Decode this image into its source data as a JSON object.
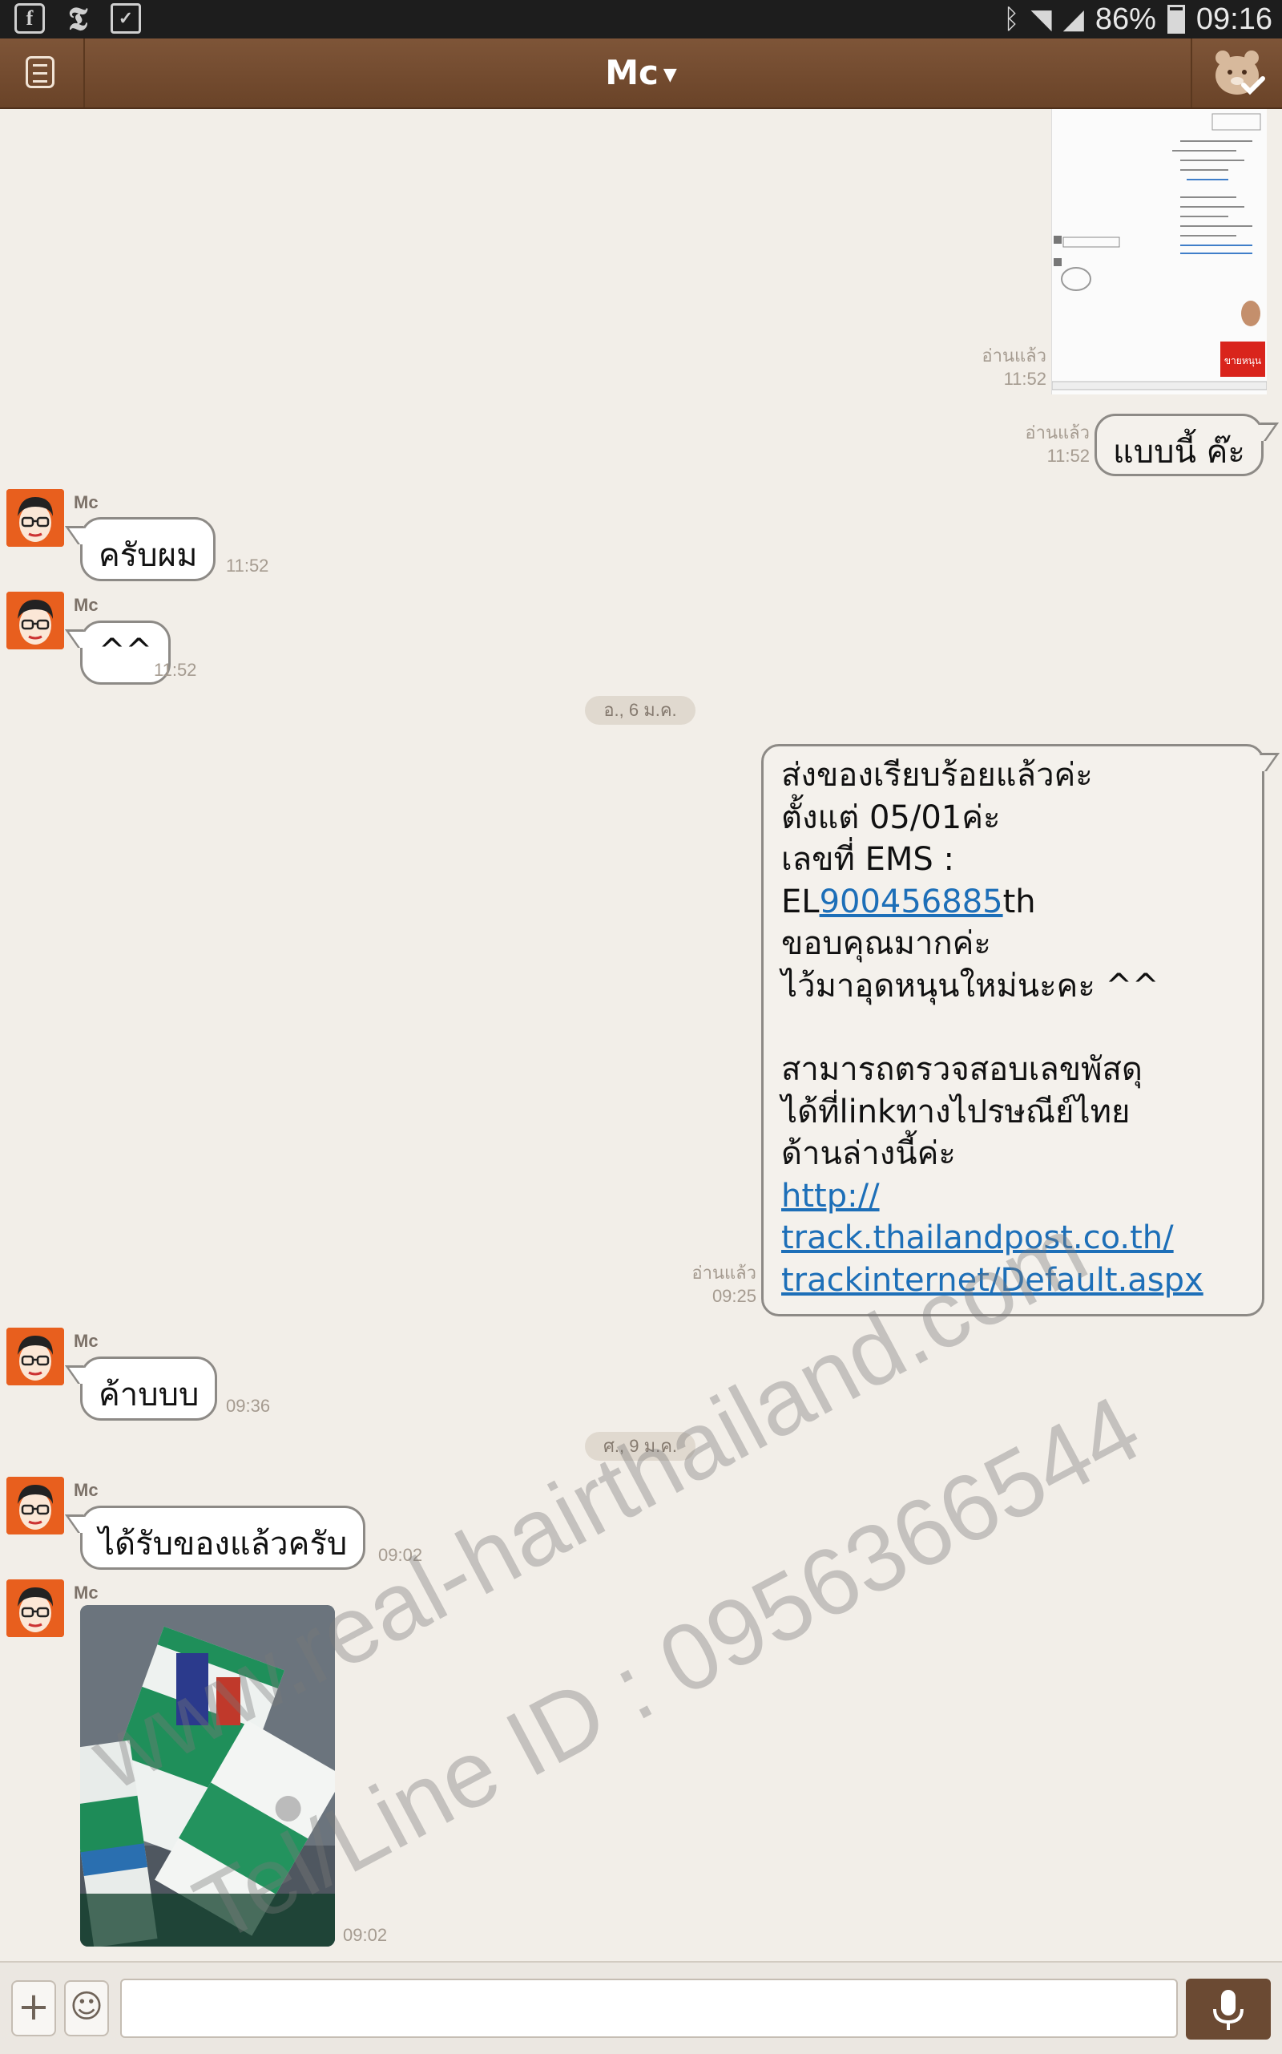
{
  "status_bar": {
    "left_icons": [
      "facebook-icon",
      "nytimes-icon",
      "briefcase-icon"
    ],
    "battery": "86%",
    "time": "09:16"
  },
  "header": {
    "title": "Mc"
  },
  "messages": {
    "m1": {
      "read": "อ่านแล้ว",
      "time": "11:52"
    },
    "m2": {
      "read": "อ่านแล้ว",
      "time": "11:52",
      "text": "แบบนี้ ค๊ะ"
    },
    "m3": {
      "sender": "Mc",
      "text": "ครับผม",
      "time": "11:52"
    },
    "m4": {
      "sender": "Mc",
      "text": "^^",
      "time": "11:52"
    },
    "date1": "อ., 6 ม.ค.",
    "m5": {
      "read": "อ่านแล้ว",
      "time": "09:25",
      "lines": [
        "ส่งของเรียบร้อยแล้วค่ะ",
        "ตั้งแต่ 05/01ค่ะ",
        "เลขที่ EMS :"
      ],
      "ems_prefix": "EL",
      "ems_number": "900456885",
      "ems_suffix": "th",
      "lines2": [
        "ขอบคุณมากค่ะ",
        "ไว้มาอุดหนุนใหม่นะคะ ^^",
        "",
        "สามารถตรวจสอบเลขพัสดุ",
        "ได้ที่linkทางไปรษณีย์ไทย",
        "ด้านล่างนี้ค่ะ"
      ],
      "link_lines": [
        "http://",
        "track.thailandpost.co.th/",
        "trackinternet/Default.aspx"
      ]
    },
    "m6": {
      "sender": "Mc",
      "text": "ค้าบบบ",
      "time": "09:36"
    },
    "date2": "ศ., 9 ม.ค.",
    "m7": {
      "sender": "Mc",
      "text": "ได้รับของแล้วครับ",
      "time": "09:02"
    },
    "m8": {
      "sender": "Mc",
      "time": "09:02"
    }
  },
  "watermark": {
    "line1": "www.real-hairthailand.com",
    "line2": "Tel/Line ID : 0956366544"
  },
  "colors": {
    "header": "#6f472b",
    "background": "#f2eee8",
    "link": "#1d6fb8",
    "avatar": "#e85f1e"
  }
}
